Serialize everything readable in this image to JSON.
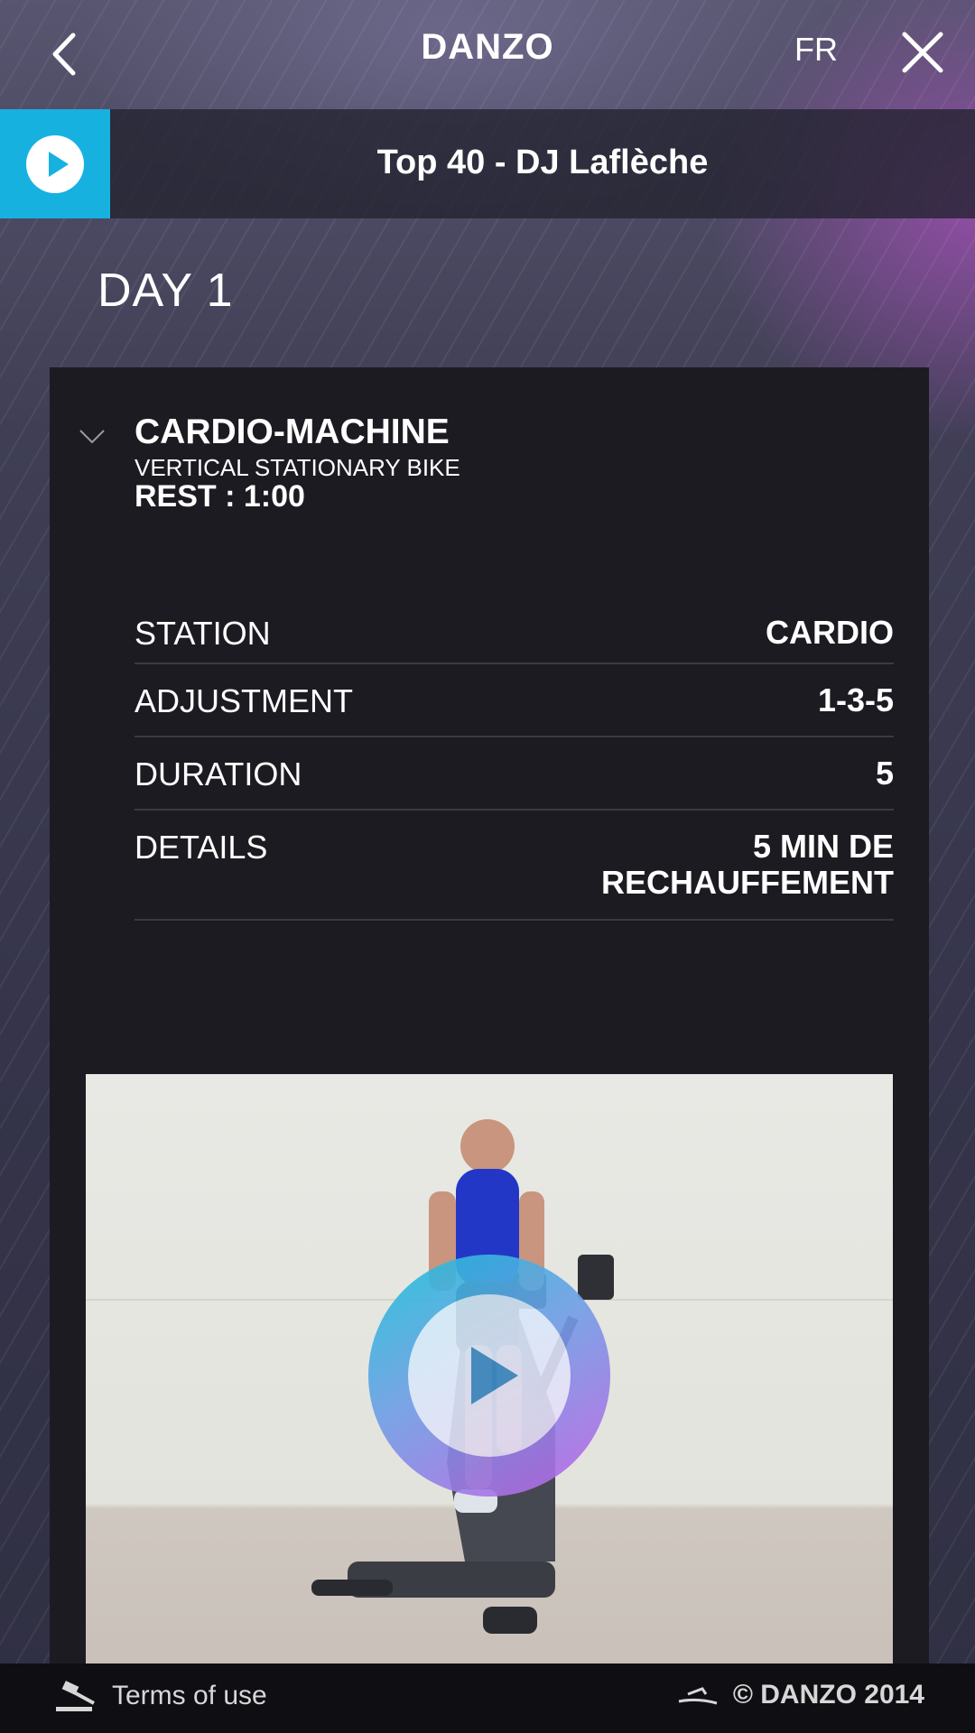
{
  "header": {
    "title": "DANZO",
    "language": "FR",
    "back_icon": "chevron-left-icon",
    "close_icon": "close-icon"
  },
  "music": {
    "track": "Top 40 - DJ Laflèche",
    "accent": "#17b1e0"
  },
  "day": {
    "title": "DAY 1"
  },
  "exercise": {
    "name": "CARDIO-MACHINE",
    "subtitle": "VERTICAL STATIONARY BIKE",
    "rest": "REST : 1:00",
    "details": [
      {
        "label": "STATION",
        "value": "CARDIO"
      },
      {
        "label": "ADJUSTMENT",
        "value": "1-3-5"
      },
      {
        "label": "DURATION",
        "value": "5"
      },
      {
        "label": "DETAILS",
        "value": "5 MIN DE RECHAUFFEMENT"
      }
    ]
  },
  "video": {
    "play_icon": "play-icon"
  },
  "footer": {
    "terms": "Terms of use",
    "copyright": "© DANZO 2014"
  }
}
